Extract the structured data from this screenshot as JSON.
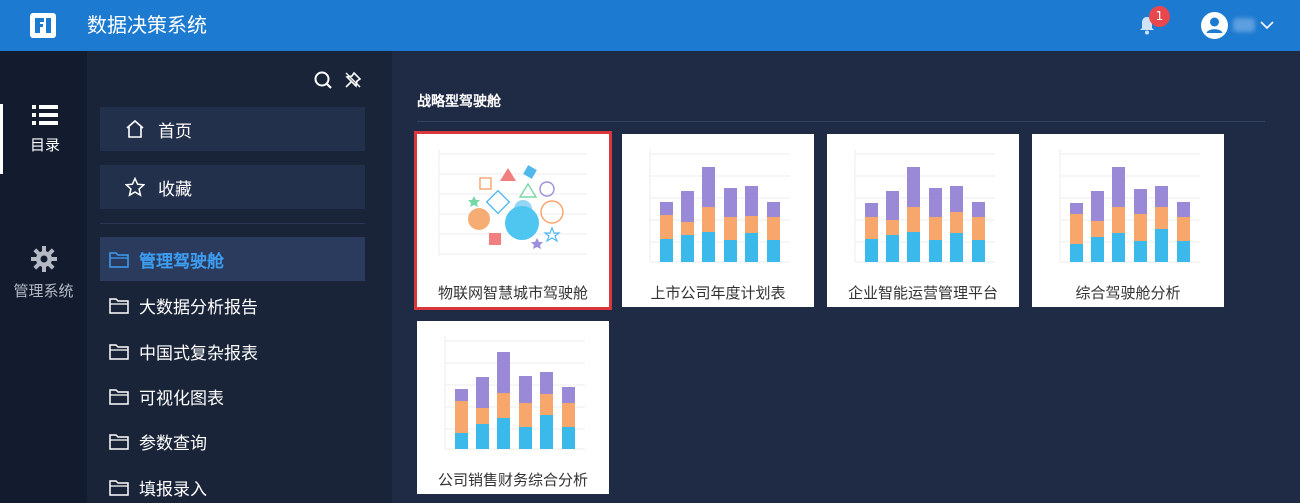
{
  "header": {
    "title": "数据决策系统",
    "notification_count": "1",
    "colors": {
      "bar": "#1c7ad0",
      "badge": "#e8474e"
    }
  },
  "rail": {
    "items": [
      {
        "label": "目录",
        "icon": "list-icon",
        "active": true
      },
      {
        "label": "管理系统",
        "icon": "gear-icon",
        "active": false
      }
    ]
  },
  "sidebar": {
    "tools": [
      "search-icon",
      "pin-icon"
    ],
    "cards": [
      {
        "label": "首页",
        "icon": "home-icon"
      },
      {
        "label": "收藏",
        "icon": "star-icon"
      }
    ],
    "folders": [
      {
        "label": "管理驾驶舱",
        "active": true
      },
      {
        "label": "大数据分析报告",
        "active": false
      },
      {
        "label": "中国式复杂报表",
        "active": false
      },
      {
        "label": "可视化图表",
        "active": false
      },
      {
        "label": "参数查询",
        "active": false
      },
      {
        "label": "填报录入",
        "active": false
      }
    ],
    "colors": {
      "active_text": "#3d9ef1"
    }
  },
  "main": {
    "section_title": "战略型驾驶舱",
    "tiles": [
      {
        "label": "物联网智慧城市驾驶舱",
        "thumbnail": "shapes",
        "selected": true
      },
      {
        "label": "上市公司年度计划表",
        "thumbnail": "stacked-bar",
        "selected": false
      },
      {
        "label": "企业智能运营管理平台",
        "thumbnail": "stacked-bar",
        "selected": false
      },
      {
        "label": "综合驾驶舱分析",
        "thumbnail": "stacked-bar",
        "selected": false
      },
      {
        "label": "公司销售财务综合分析",
        "thumbnail": "stacked-bar",
        "selected": false
      }
    ]
  }
}
